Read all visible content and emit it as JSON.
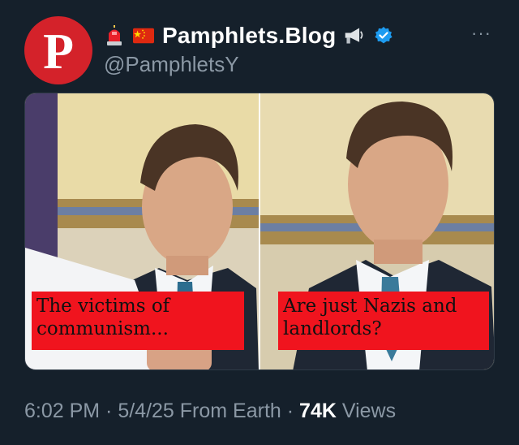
{
  "tweet": {
    "avatar_letter": "P",
    "display_name": "Pamphlets.Blog",
    "handle": "@PamphletsY",
    "icons": [
      "police-light-icon",
      "china-flag-icon",
      "megaphone-icon",
      "verified-badge-icon"
    ],
    "more_label": "···",
    "media": {
      "caption_left": "The victims of communism...",
      "caption_right": "Are just Nazis and landlords?"
    },
    "meta": {
      "time": "6:02 PM",
      "sep1": " · ",
      "date": "5/4/25",
      "source": " From Earth",
      "sep2": " · ",
      "views_count": "74K",
      "views_label": " Views"
    }
  },
  "colors": {
    "background": "#15202b",
    "secondary_text": "#8b98a5",
    "verified_blue": "#1d9bf0",
    "caption_red": "#f0141e",
    "avatar_red": "#d4222a"
  }
}
